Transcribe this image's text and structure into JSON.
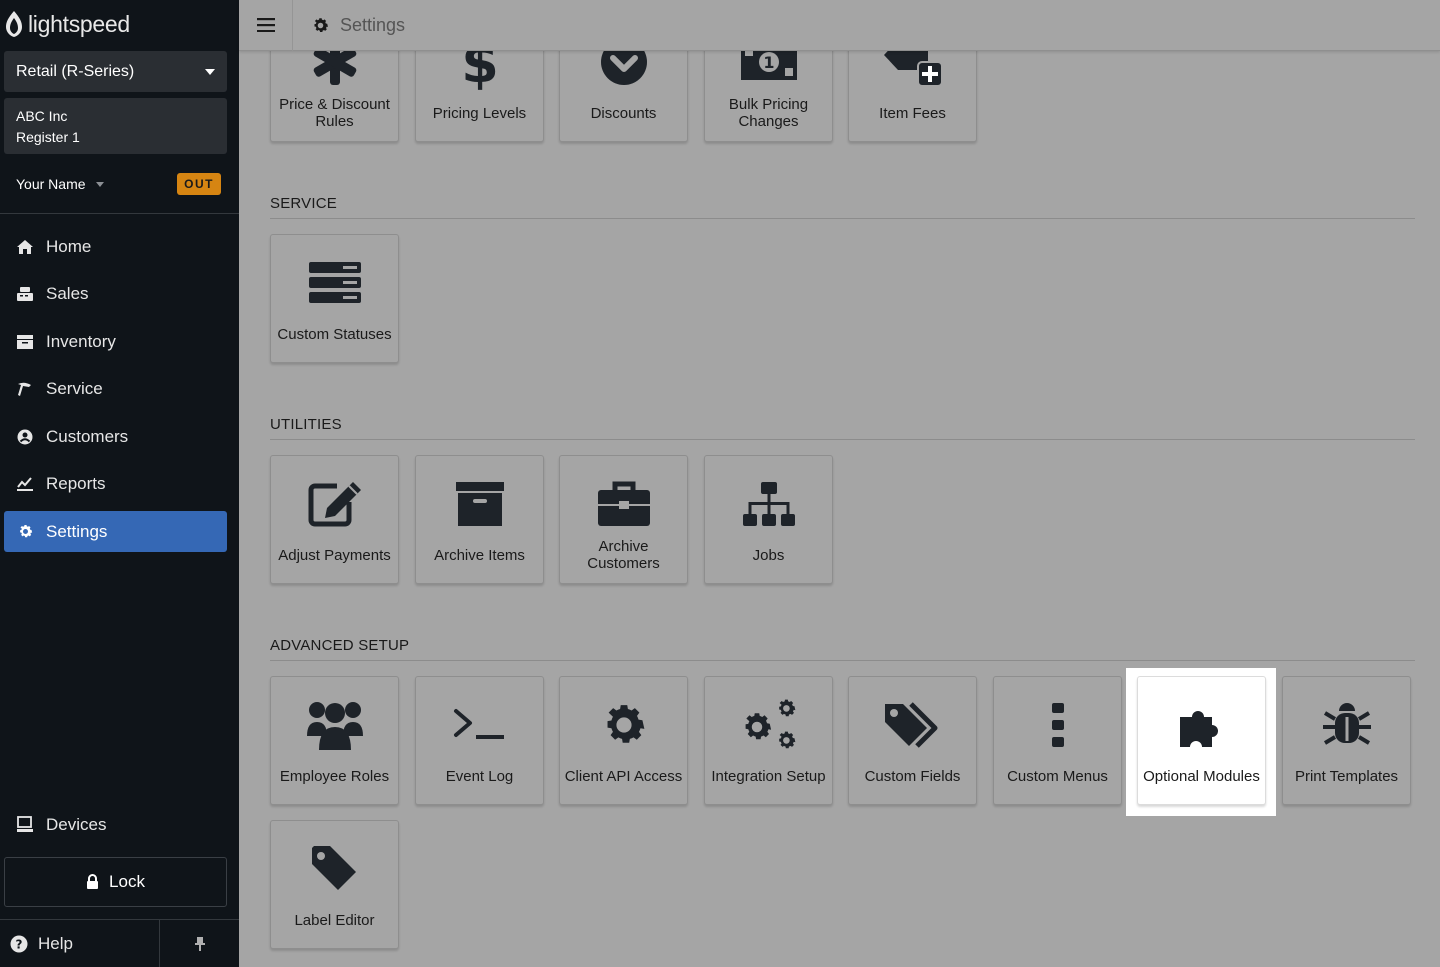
{
  "app": {
    "logo_text": "lightspeed"
  },
  "sidebar": {
    "product": "Retail (R-Series)",
    "company": "ABC Inc",
    "register": "Register 1",
    "user_name": "Your Name",
    "clock_badge": "OUT",
    "nav": [
      {
        "label": "Home",
        "icon": "home-icon"
      },
      {
        "label": "Sales",
        "icon": "sales-icon"
      },
      {
        "label": "Inventory",
        "icon": "inventory-icon"
      },
      {
        "label": "Service",
        "icon": "service-icon"
      },
      {
        "label": "Customers",
        "icon": "customers-icon"
      },
      {
        "label": "Reports",
        "icon": "reports-icon"
      },
      {
        "label": "Settings",
        "icon": "gear-icon",
        "active": true
      }
    ],
    "devices": "Devices",
    "lock": "Lock",
    "help": "Help"
  },
  "header": {
    "title": "Settings"
  },
  "sections": {
    "pricing": {
      "tiles": [
        {
          "label": "Price & Discount Rules",
          "icon": "asterisk-icon"
        },
        {
          "label": "Pricing Levels",
          "icon": "dollar-icon"
        },
        {
          "label": "Discounts",
          "icon": "discount-chevron-icon"
        },
        {
          "label": "Bulk Pricing Changes",
          "icon": "money-bill-icon"
        },
        {
          "label": "Item Fees",
          "icon": "tag-plus-icon"
        }
      ]
    },
    "service": {
      "title": "SERVICE",
      "tiles": [
        {
          "label": "Custom Statuses",
          "icon": "server-stack-icon"
        }
      ]
    },
    "utilities": {
      "title": "UTILITIES",
      "tiles": [
        {
          "label": "Adjust Payments",
          "icon": "edit-icon"
        },
        {
          "label": "Archive Items",
          "icon": "archive-box-icon"
        },
        {
          "label": "Archive Customers",
          "icon": "briefcase-icon"
        },
        {
          "label": "Jobs",
          "icon": "sitemap-icon"
        }
      ]
    },
    "advanced": {
      "title": "ADVANCED SETUP",
      "tiles": [
        {
          "label": "Employee Roles",
          "icon": "users-icon"
        },
        {
          "label": "Event Log",
          "icon": "terminal-icon"
        },
        {
          "label": "Client API Access",
          "icon": "gear-icon"
        },
        {
          "label": "Integration Setup",
          "icon": "gears-icon"
        },
        {
          "label": "Custom Fields",
          "icon": "tags-icon"
        },
        {
          "label": "Custom Menus",
          "icon": "vertical-ellipsis-icon"
        },
        {
          "label": "Optional Modules",
          "icon": "puzzle-icon",
          "highlighted": true
        },
        {
          "label": "Print Templates",
          "icon": "bug-icon"
        },
        {
          "label": "Label Editor",
          "icon": "tag-icon"
        }
      ]
    }
  },
  "colors": {
    "sidebar_bg": "#0f1419",
    "active_nav": "#3568b5",
    "badge": "#d68512",
    "overlay_bg": "#a5a5a5"
  }
}
